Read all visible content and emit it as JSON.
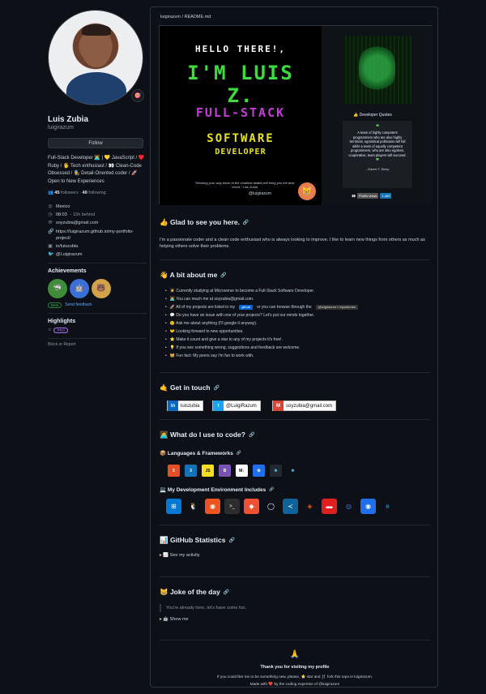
{
  "profile": {
    "name": "Luis Zubia",
    "login": "luigirazum",
    "follow_label": "Follow",
    "bio": "Full-Stack Developer 👨‍💻 | 💛 JavaScript / ♥️ Ruby / 🖐️ Tech enthusiast / 👀 Clean-Code Obsessed / 👨‍🔧 Detail-Oriented coder / 🚀 Open to New Experiences",
    "followers_count": "45",
    "followers_label": "followers",
    "following_count": "40",
    "following_label": "following",
    "status_emoji": "🎯",
    "location": "Mexico",
    "localtime": "08:03",
    "localtime_note": "- 15h behind",
    "email": "soyzubia@gmail.com",
    "website": "https://luigirazum.github.io/my-portfolio-project/",
    "linkedin": "in/luiszubia",
    "twitter": "@Luigirazum"
  },
  "achievements": {
    "title": "Achievements",
    "badges": [
      "🦈",
      "🤖",
      "🐻"
    ],
    "badge_count": "x2",
    "beta_label": "Beta",
    "feedback_label": "Send feedback"
  },
  "highlights": {
    "title": "Highlights",
    "pro_label": "PRO",
    "block_label": "Block or Report"
  },
  "readme": {
    "path": "luigirazum / README.md",
    "hero": {
      "hello": "HELLO THERE!,",
      "im": "I'M LUIS Z.",
      "fullstack": "FULL-STACK",
      "software": "SOFTWARE",
      "developer": "DEVELOPER",
      "quote": "\"Working your way down to the smallest details will bring you the best result,\" Luis Zubia",
      "handle": "@luigirazum",
      "devq_title": "👍 Developer Quotes",
      "devq_text": "A team of highly competent programmers who are also highly territorial, egotistical politicians will fail while a team of equally competent programmers, who are also egoless, cooperative, team players will succeed.",
      "devq_author": "- Daniel T. Barry",
      "views_label": "Profile views",
      "views_count": "1,489"
    },
    "glad_title": "👍 Glad to see you here.",
    "glad_text": "I'm a passionate coder and a clean code enthusiast who is always looking to improve. I like to learn new things from others as much as helping others solve their problems.",
    "about_title": "👋 A bit about me",
    "about_items": [
      "🧑‍🎓 Currently studying at Microverse to become a Full-Stack Software Developer.",
      "🧑‍💻 You can reach me at soyzubia@gmail.com.",
      "🚀 All of my projects are listed in my",
      "💬 Do you have an issue with one of your projects? Let's put our minds together.",
      "🧐 Ask me about anything (I'll google it anyway).",
      "🤝 Looking forward to new opportunities.",
      "⭐ Make it count and give a star to any of my projects it's free!.",
      "💡 If you see something wrong, suggestions and feedback are welcome.",
      "😸 Fun fact: My peers say I'm fun to work with."
    ],
    "about_projects_chip": "github",
    "about_projects_mid": "or you can browse through the",
    "about_projects_chip2": "@luigirazum / repositories",
    "contact_title": "🤙 Get in touch",
    "contacts": [
      {
        "icon": "in",
        "label": "luiszubia",
        "color": "#0a66c2"
      },
      {
        "icon": "t",
        "label": "@LuigiRazum",
        "color": "#1da1f2"
      },
      {
        "icon": "M",
        "label": "soyzubia@gmail.com",
        "color": "#d44638"
      }
    ],
    "tools_title": "👩‍💻 What do I use to code?",
    "langs_title": "📦 Languages & Frameworks",
    "langs": [
      {
        "label": "5",
        "color": "#e34f26"
      },
      {
        "label": "3",
        "color": "#1572b6"
      },
      {
        "label": "JS",
        "color": "#f7df1e"
      },
      {
        "label": "B",
        "color": "#7952b3"
      },
      {
        "label": "M↓",
        "color": "#ffffff"
      },
      {
        "label": "⚙",
        "color": "#1f6feb"
      },
      {
        "label": "⚛",
        "color": "#23272f"
      },
      {
        "label": "⚛",
        "color": "#0d1117"
      }
    ],
    "env_title": "💻 My Development Environment Includes",
    "env": [
      {
        "label": "⊞",
        "color": "#0078d4"
      },
      {
        "label": "🐧",
        "color": "#0d1117"
      },
      {
        "label": "◉",
        "color": "#e95420"
      },
      {
        "label": ">_",
        "color": "#2d2d2d"
      },
      {
        "label": "◆",
        "color": "#f05032"
      },
      {
        "label": "◯",
        "color": "#0d1117"
      },
      {
        "label": "≺",
        "color": "#0e639c"
      },
      {
        "label": "◈",
        "color": "#0d1117"
      },
      {
        "label": "▬",
        "color": "#e01e1e"
      },
      {
        "label": "◎",
        "color": "#0d1117"
      },
      {
        "label": "◉",
        "color": "#1f6feb"
      },
      {
        "label": "e",
        "color": "#0d1117"
      }
    ],
    "stats_title": "📊 GitHub Statistics",
    "stats_details": "▸ 📈 See my activity",
    "joke_title": "😸 Joke of the day",
    "joke_text": "You're already here, let's have some fun.",
    "joke_details": "▸ 🤖 Show me",
    "footer_title": "Thank you for visiting my profile",
    "footer_line1": "If you could like me to be something new, please, ⭐ star and 🍴 fork this repo in luigirazum.",
    "footer_line2": "Made with ❤️ by the coding expertise of @luigirazum"
  },
  "colors": {
    "accent": "#58a6ff",
    "bg": "#0d1117",
    "border": "#30363d"
  }
}
